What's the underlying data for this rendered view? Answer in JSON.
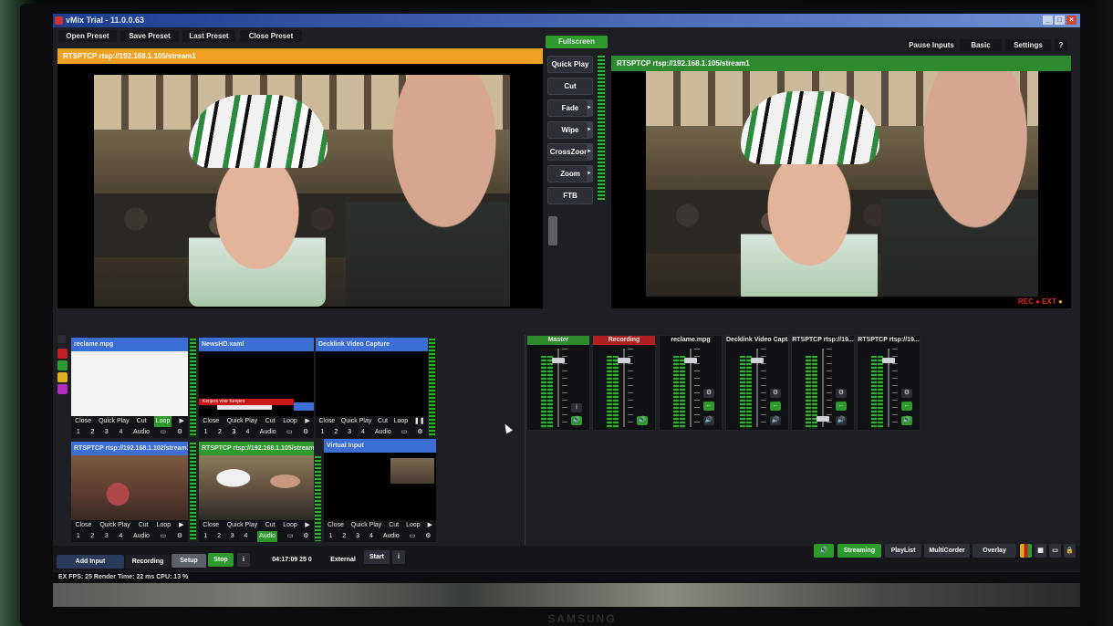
{
  "window": {
    "title": "vMix Trial - 11.0.0.63"
  },
  "toolbar": {
    "open_preset": "Open Preset",
    "save_preset": "Save Preset",
    "last_preset": "Last Preset",
    "close_preset": "Close Preset",
    "fullscreen": "Fullscreen",
    "pause_inputs": "Pause Inputs",
    "basic": "Basic",
    "settings": "Settings",
    "help": "?"
  },
  "preview": {
    "title": "RTSPTCP rtsp://192.168.1.105/stream1",
    "color": "#f0a020"
  },
  "output": {
    "title": "RTSPTCP rtsp://192.168.1.105/stream1",
    "color": "#2e8a2e",
    "rec": "REC",
    "ext": "EXT"
  },
  "transitions": {
    "quick_play": "Quick Play",
    "cut": "Cut",
    "fade": "Fade",
    "wipe": "Wipe",
    "crosszoom": "CrossZoom",
    "zoom": "Zoom",
    "ftb": "FTB"
  },
  "inputs": [
    {
      "title": "reclame.mpg",
      "close": "Close",
      "quick_play": "Quick Play",
      "cut": "Cut",
      "loop": "Loop",
      "n1": "1",
      "n2": "2",
      "n3": "3",
      "n4": "4",
      "audio": "Audio"
    },
    {
      "title": "NewsHD.xaml",
      "lower_third": "Kenjers voor Kenjers",
      "close": "Close",
      "quick_play": "Quick Play",
      "cut": "Cut",
      "loop": "Loop",
      "n1": "1",
      "n2": "2",
      "n3": "3",
      "n4": "4",
      "audio": "Audio"
    },
    {
      "title": "Decklink Video Capture",
      "close": "Close",
      "quick_play": "Quick Play",
      "cut": "Cut",
      "loop": "Loop",
      "n1": "1",
      "n2": "2",
      "n3": "3",
      "n4": "4",
      "audio": "Audio"
    },
    {
      "title": "RTSPTCP rtsp://192.168.1.102/stream1",
      "close": "Close",
      "quick_play": "Quick Play",
      "cut": "Cut",
      "loop": "Loop",
      "n1": "1",
      "n2": "2",
      "n3": "3",
      "n4": "4",
      "audio": "Audio"
    },
    {
      "title": "RTSPTCP rtsp://192.168.1.105/stream1",
      "close": "Close",
      "quick_play": "Quick Play",
      "cut": "Cut",
      "loop": "Loop",
      "n1": "1",
      "n2": "2",
      "n3": "3",
      "n4": "4",
      "audio": "Audio"
    },
    {
      "title": "Virtual Input",
      "close": "Close",
      "quick_play": "Quick Play",
      "cut": "Cut",
      "loop": "Loop",
      "n1": "1",
      "n2": "2",
      "n3": "3",
      "n4": "4",
      "audio": "Audio"
    }
  ],
  "mixer": [
    {
      "title": "Master",
      "color": "#2e8a2e"
    },
    {
      "title": "Recording",
      "color": "#b02020"
    },
    {
      "title": "reclame.mpg",
      "color": "#101114"
    },
    {
      "title": "Decklink Video Capt...",
      "color": "#101114"
    },
    {
      "title": "RTSPTCP rtsp://19...",
      "color": "#101114"
    },
    {
      "title": "RTSPTCP rtsp://19...",
      "color": "#101114"
    }
  ],
  "bottom": {
    "add_input": "Add Input",
    "recording": "Recording",
    "setup": "Setup",
    "stop": "Stop",
    "info": "i",
    "timecode": "04:17:09 25 0",
    "external": "External",
    "start": "Start",
    "streaming": "Streaming",
    "playlist": "PlayList",
    "multicorder": "MultiCorder",
    "overlay": "Overlay"
  },
  "status": {
    "fps": "EX FPS: 25 Render Time: 22 ms CPU: 13 %"
  }
}
